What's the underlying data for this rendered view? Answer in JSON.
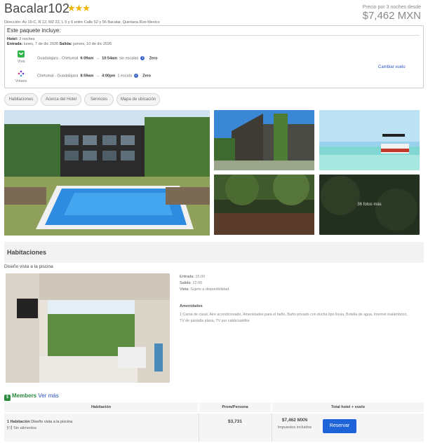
{
  "hotel": {
    "name": "Bacalar102",
    "stars": "★★★",
    "address": "Dirección: Av 19-C, R 12, MZ 22, L 5 y 6 entre Calle 52 y 56 Bacalar, Quintana Roo Mexico",
    "price_caption": "Precio por 3 noches desde",
    "price": "$7,462 MXN"
  },
  "package": {
    "title": "Este paquete incluye:",
    "hotel_label": "Hotel:",
    "hotel_value": "3 noches",
    "checkin_label": "Entrada:",
    "checkin_value": "lunes, 7 de dic 2026",
    "checkout_label": "Salida:",
    "checkout_value": "jueves, 10 de dic 2026",
    "flights": [
      {
        "airline": "Viva",
        "route": "Guadalajara - Chetumal",
        "depart": "6:09am",
        "arrow": "→",
        "arrive": "10:54am",
        "stops": "sin escalas",
        "fare": "Zero"
      },
      {
        "airline": "Volaris",
        "route": "Chetumal - Guadalajara",
        "depart": "8:59am",
        "arrow": "→",
        "arrive": "4:00pm",
        "stops": "1 escala",
        "fare": "Zero"
      }
    ],
    "change_flight": "Cambiar vuelo"
  },
  "tabs": [
    "Habitaciones",
    "Acerca del Hotel",
    "Servicios",
    "Mapa de ubicación"
  ],
  "gallery": {
    "more_photos": "36 fotos más"
  },
  "rooms_section": {
    "title": "Habitaciones",
    "room_name": "Diseño vista a la piscina",
    "checkin_label": "Entrada:",
    "checkin_time": "15:00",
    "checkout_label": "Salida:",
    "checkout_time": "12:00",
    "view_label": "Vista:",
    "view_value": "Sujeto a disponibilidad",
    "amenities_title": "Amenidades",
    "amenities": "1 Cama de casal, Aire acondicionado, Amenidades para el baño, Baño privado con ducha tipo lluvia, Botella de agua, Internet inalámbrico, TV de pantalla plana, TV por cable/satélite"
  },
  "members": {
    "label": "Members",
    "more": "Ver más"
  },
  "rates_table": {
    "headers": [
      "Habitación",
      "Prom/Persona",
      "Total hotel + vuelo"
    ],
    "row": {
      "room_count": "1 Habitación",
      "room_type": "Diseño vista a la piscina",
      "meal_plan": "Sin alimentos",
      "per_person": "$3,731",
      "total": "$7,462 MXN",
      "taxes": "Impuestos incluidos",
      "button": "Reservar"
    }
  },
  "colors": {
    "accent": "#1f63d8",
    "link": "#2a55c6",
    "members": "#2b8a3e",
    "star": "#f0b400"
  }
}
